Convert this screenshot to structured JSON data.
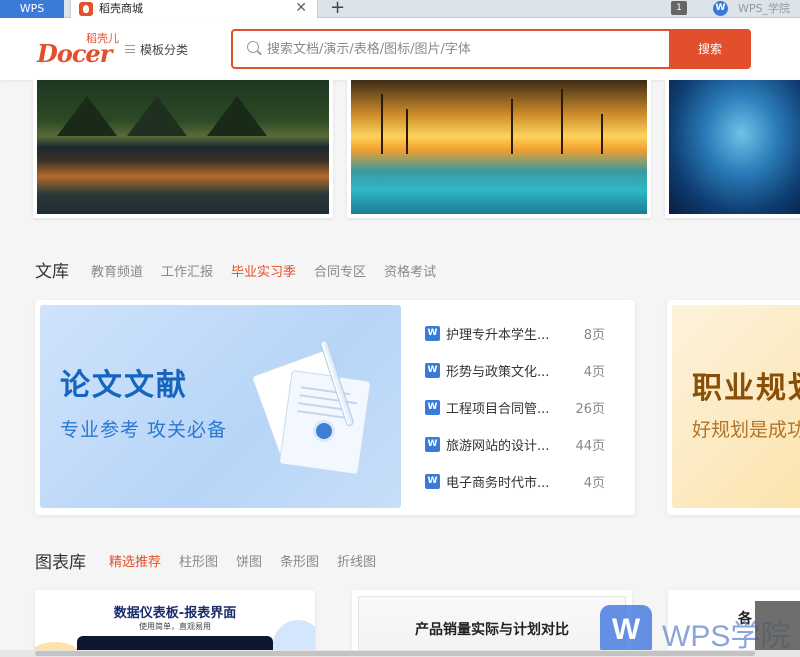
{
  "browser": {
    "tabs": [
      {
        "label": "WPS"
      },
      {
        "label": "稻壳商城",
        "active": true
      }
    ],
    "tab_count": "1",
    "right_tab": "WPS_学院"
  },
  "header": {
    "logo_sub": "稻壳儿",
    "logo_word": "Docer",
    "category_menu": "模板分类",
    "search_placeholder": "搜索文档/演示/表格/图标/图片/字体",
    "search_button": "搜索",
    "brand_color": "#e2502b"
  },
  "library": {
    "title": "文库",
    "tabs": [
      "教育频道",
      "工作汇报",
      "毕业实习季",
      "合同专区",
      "资格考试"
    ],
    "active_tab": "毕业实习季",
    "feature": {
      "heading": "论文文献",
      "subheading": "专业参考 攻关必备"
    },
    "docs": [
      {
        "name": "护理专升本学生...",
        "pages": "8页"
      },
      {
        "name": "形势与政策文化...",
        "pages": "4页"
      },
      {
        "name": "工程项目合同管...",
        "pages": "26页"
      },
      {
        "name": "旅游网站的设计...",
        "pages": "44页"
      },
      {
        "name": "电子商务时代市...",
        "pages": "4页"
      }
    ],
    "side_feature": {
      "heading": "职业规划",
      "subheading": "好规划是成功"
    }
  },
  "charts": {
    "title": "图表库",
    "tabs": [
      "精选推荐",
      "柱形图",
      "饼图",
      "条形图",
      "折线图"
    ],
    "active_tab": "精选推荐",
    "cards": [
      {
        "title": "数据仪表板-报表界面",
        "subtitle": "使用简单，直观易用"
      },
      {
        "title": "产品销量实际与计划对比"
      },
      {
        "title": "各"
      }
    ]
  },
  "watermark": {
    "text": "WPS学院",
    "badge": "W"
  }
}
